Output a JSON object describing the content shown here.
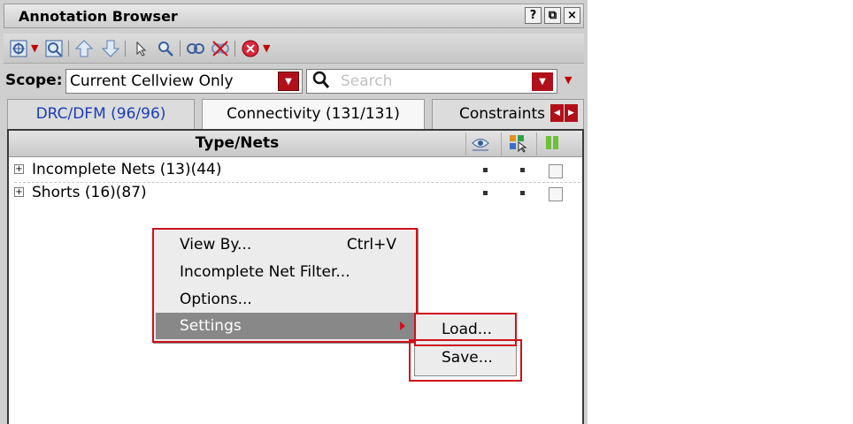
{
  "window": {
    "title": "Annotation Browser",
    "buttons": [
      "?",
      "⧉",
      "×"
    ]
  },
  "toolbar": {
    "icons": [
      "zoom-fit-icon",
      "zoom-select-icon",
      "arrow-up-icon",
      "arrow-down-icon",
      "pointer-icon",
      "magnifier-icon",
      "link-icon",
      "unlink-icon",
      "stop-icon"
    ]
  },
  "scope": {
    "label": "Scope:",
    "value": "Current Cellview Only"
  },
  "search": {
    "placeholder": "Search"
  },
  "tabs": [
    {
      "label": "DRC/DFM (96/96)",
      "active": false
    },
    {
      "label": "Connectivity (131/131)",
      "active": true
    },
    {
      "label": "Constraints",
      "active": false
    }
  ],
  "tree": {
    "header": "Type/Nets",
    "columns": [
      "visibility-icon",
      "select-icon",
      "flag-icon"
    ],
    "rows": [
      {
        "label": "Incomplete Nets (13)(44)"
      },
      {
        "label": "Shorts (16)(87)"
      }
    ]
  },
  "context_menu": {
    "items": [
      {
        "label": "View By...",
        "shortcut": "Ctrl+V"
      },
      {
        "label": "Incomplete Net Filter...",
        "shortcut": ""
      },
      {
        "label": "Options...",
        "shortcut": ""
      },
      {
        "label": "Settings",
        "shortcut": "",
        "submenu": true
      }
    ],
    "submenu": [
      {
        "label": "Load..."
      },
      {
        "label": "Save..."
      }
    ]
  },
  "colors": {
    "highlight_border": "#d0101a",
    "dropdown_red": "#b0101a",
    "active_tab_text": "#1b3db7",
    "selected_menu_bg": "#888888"
  }
}
